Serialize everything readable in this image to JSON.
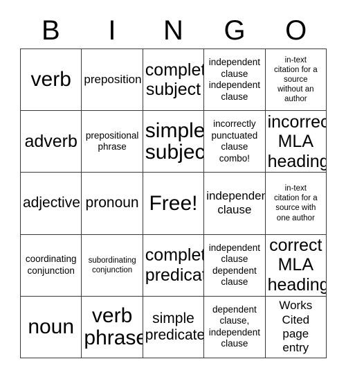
{
  "card": {
    "title": "BINGO",
    "header_letters": [
      "B",
      "I",
      "N",
      "G",
      "O"
    ],
    "free_space_label": "Free!",
    "border_color": "#3a3a3a",
    "background_color": "#ffffff",
    "text_color": "#000000",
    "columns": 5,
    "rows": 5,
    "cells": [
      [
        {
          "text": "verb",
          "size": "xxl"
        },
        {
          "text": "preposition",
          "size": "md"
        },
        {
          "text": "complete\nsubject",
          "size": "xl"
        },
        {
          "text": "independent\nclause\nindependent\nclause",
          "size": "sm"
        },
        {
          "text": "in-text\ncitation for a\nsource\nwithout an\nauthor",
          "size": "xs"
        }
      ],
      [
        {
          "text": "adverb",
          "size": "xl"
        },
        {
          "text": "prepositional\nphrase",
          "size": "sm"
        },
        {
          "text": "simple\nsubject",
          "size": "xxl"
        },
        {
          "text": "incorrectly\npunctuated\nclause\ncombo!",
          "size": "sm"
        },
        {
          "text": "incorrect\nMLA\nheading",
          "size": "xl"
        }
      ],
      [
        {
          "text": "adjective",
          "size": "lg"
        },
        {
          "text": "pronoun",
          "size": "lg"
        },
        {
          "text": "Free!",
          "size": "xxl"
        },
        {
          "text": "independent\nclause",
          "size": "md"
        },
        {
          "text": "in-text\ncitation for a\nsource with\none author",
          "size": "xs"
        }
      ],
      [
        {
          "text": "coordinating\nconjunction",
          "size": "sm"
        },
        {
          "text": "subordinating\nconjunction",
          "size": "xs"
        },
        {
          "text": "complete\npredicate",
          "size": "xl"
        },
        {
          "text": "independent\nclause\ndependent\nclause",
          "size": "sm"
        },
        {
          "text": "correct\nMLA\nheading",
          "size": "xl"
        }
      ],
      [
        {
          "text": "noun",
          "size": "xxl"
        },
        {
          "text": "verb\nphrase",
          "size": "xxl"
        },
        {
          "text": "simple\npredicate",
          "size": "lg"
        },
        {
          "text": "dependent\nclause,\nindependent\nclause",
          "size": "sm"
        },
        {
          "text": "Works\nCited\npage\nentry",
          "size": "md"
        }
      ]
    ]
  }
}
